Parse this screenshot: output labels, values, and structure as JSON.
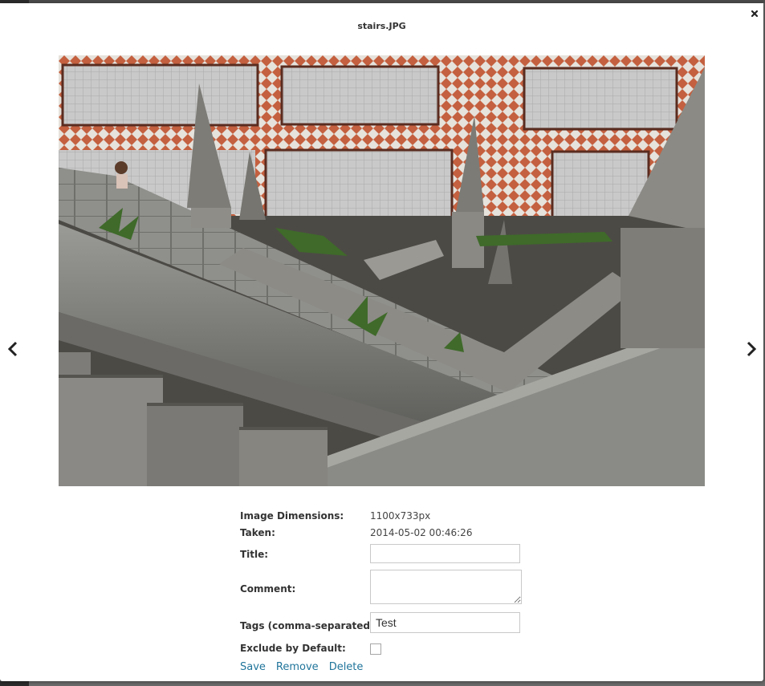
{
  "modal": {
    "title": "stairs.JPG",
    "close_label": "×"
  },
  "nav": {
    "prev_icon": "chevron-left-icon",
    "next_icon": "chevron-right-icon"
  },
  "photo": {
    "subject": "stairs"
  },
  "details": {
    "dimensions": {
      "label": "Image Dimensions:",
      "value": "1100x733px"
    },
    "taken": {
      "label": "Taken:",
      "value": "2014-05-02 00:46:26"
    },
    "title": {
      "label": "Title:",
      "value": ""
    },
    "comment": {
      "label": "Comment:",
      "value": ""
    },
    "tags": {
      "label": "Tags (comma-separated):",
      "value": "Test"
    },
    "exclude": {
      "label": "Exclude by Default:",
      "checked": false
    }
  },
  "actions": {
    "save": "Save",
    "remove": "Remove",
    "delete": "Delete"
  },
  "colors": {
    "link": "#21759b",
    "backdrop": "#5f5f5f"
  }
}
